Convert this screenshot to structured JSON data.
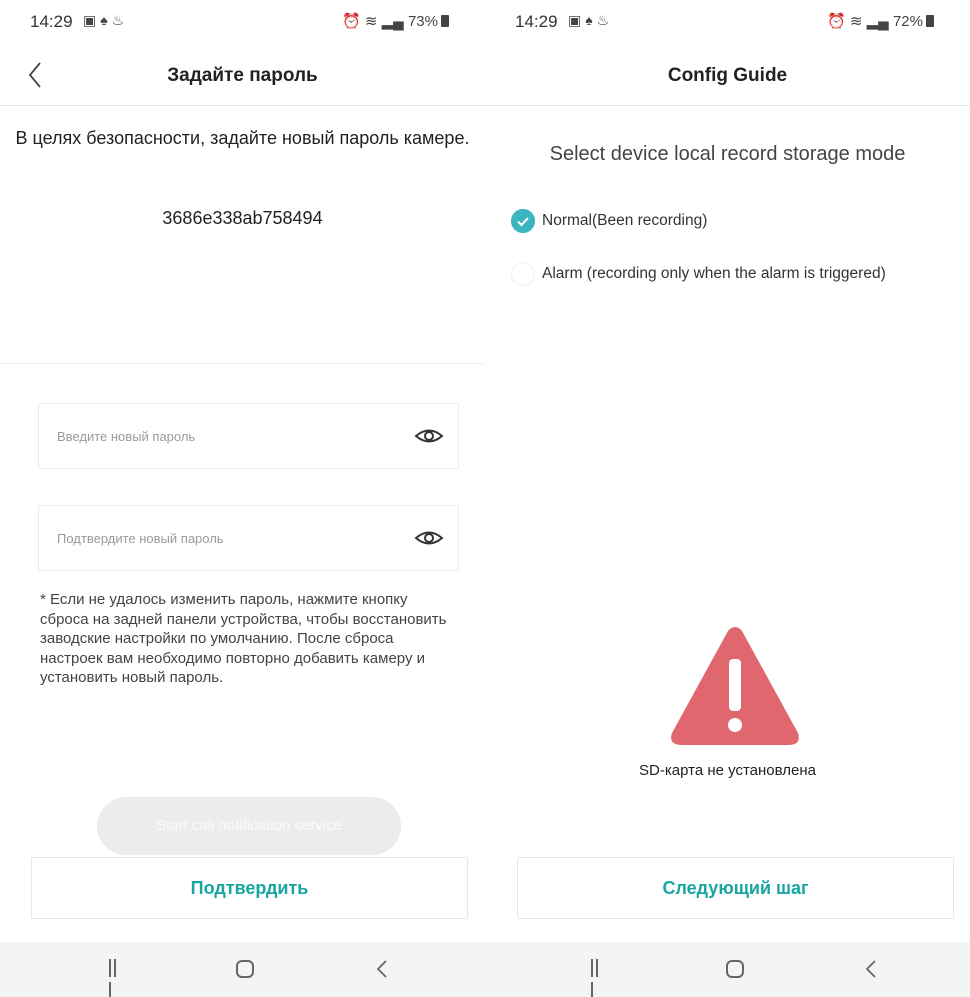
{
  "left": {
    "status": {
      "time": "14:29",
      "battery": "73%"
    },
    "title": "Задайте пароль",
    "info_text": "В целях безопасности, задайте новый пароль камере.",
    "device_id": "3686e338ab758494",
    "new_password_placeholder": "Введите новый пароль",
    "confirm_password_placeholder": "Подтвердите новый пароль",
    "note": "* Если не удалось изменить пароль, нажмите кнопку сброса на задней панели устройства, чтобы восстановить заводские настройки по умолчанию. После сброса настроек вам необходимо повторно добавить камеру и установить новый пароль.",
    "ghost_button": "Start call notification service",
    "confirm_button": "Подтвердить"
  },
  "right": {
    "status": {
      "time": "14:29",
      "battery": "72%"
    },
    "title": "Config Guide",
    "prompt": "Select device local record storage mode",
    "options": [
      {
        "label": "Normal(Been recording)",
        "selected": true
      },
      {
        "label": "Alarm (recording only when the alarm is triggered)",
        "selected": false
      }
    ],
    "sd_message": "SD-карта не установлена",
    "next_button": "Следующий шаг"
  },
  "colors": {
    "accent": "#17a6a0",
    "radio_checked": "#3bb5c0",
    "warning": "#e0676d"
  }
}
